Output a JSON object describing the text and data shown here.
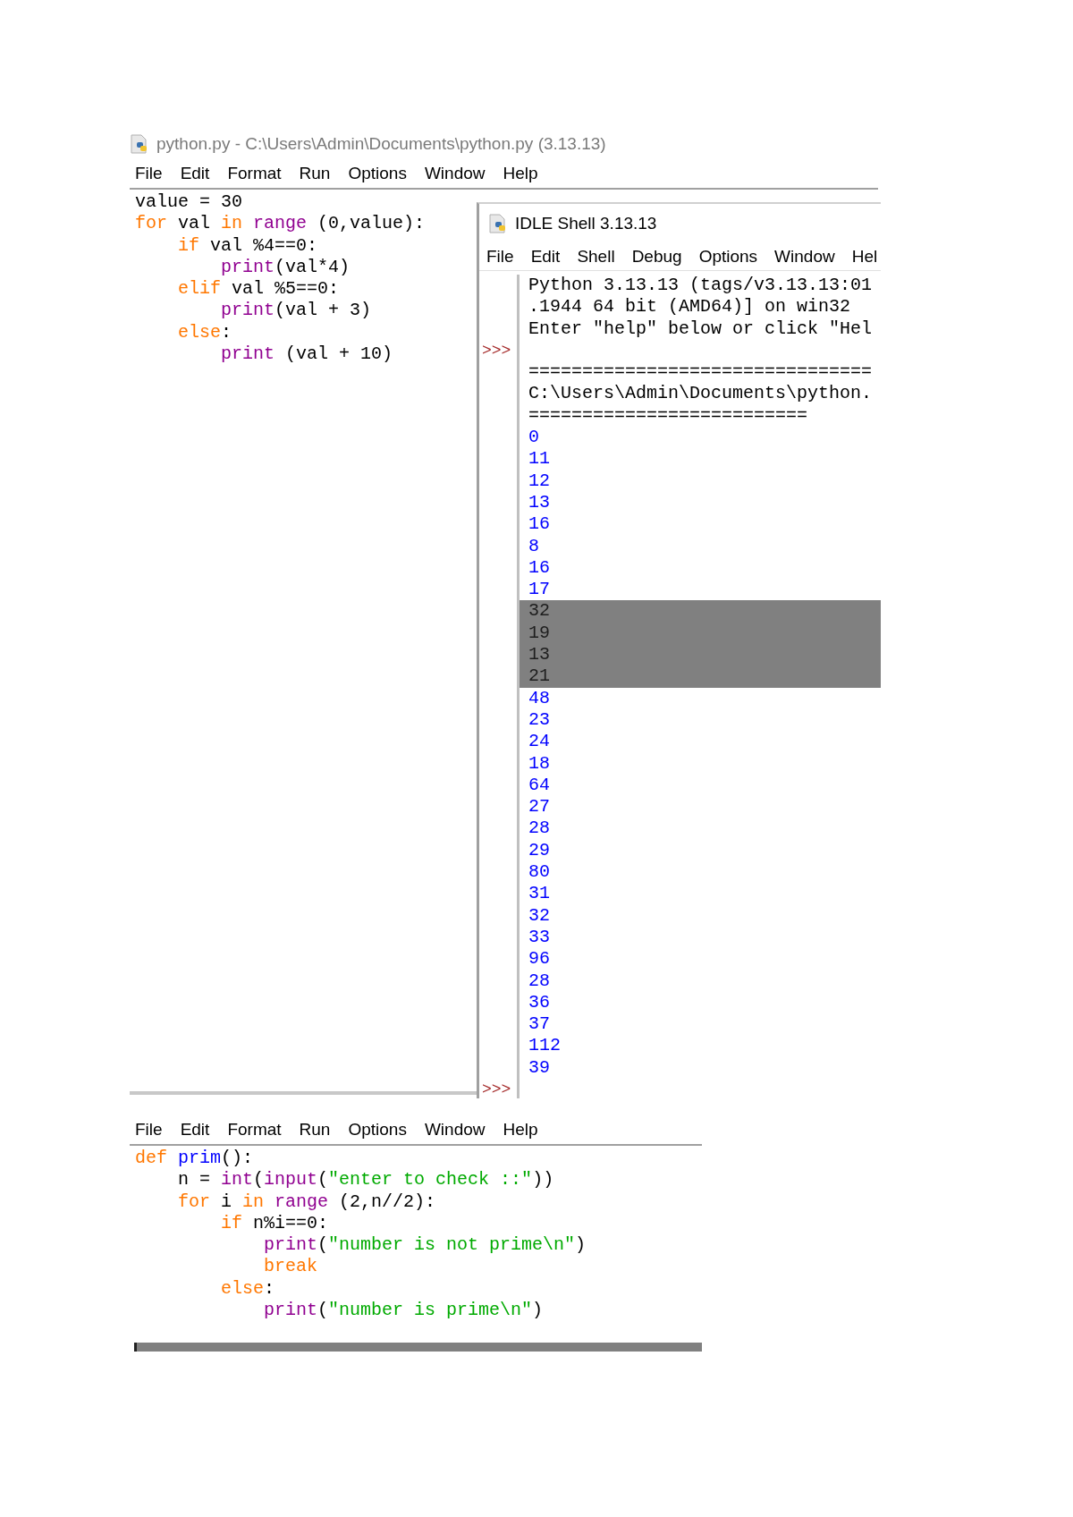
{
  "editor": {
    "title": "python.py - C:\\Users\\Admin\\Documents\\python.py (3.13.13)",
    "menu": [
      "File",
      "Edit",
      "Format",
      "Run",
      "Options",
      "Window",
      "Help"
    ],
    "code": [
      [
        {
          "text": "value = 30",
          "kind": "plain"
        }
      ],
      [
        {
          "text": "for",
          "kind": "keyword"
        },
        {
          "text": " val ",
          "kind": "plain"
        },
        {
          "text": "in",
          "kind": "keyword"
        },
        {
          "text": " range",
          "kind": "builtin"
        },
        {
          "text": " (0,value):",
          "kind": "plain"
        }
      ],
      [
        {
          "text": "    if",
          "kind": "keyword"
        },
        {
          "text": " val %4==0:",
          "kind": "plain"
        }
      ],
      [
        {
          "text": "        print",
          "kind": "builtin"
        },
        {
          "text": "(val*4)",
          "kind": "plain"
        }
      ],
      [
        {
          "text": "    elif",
          "kind": "keyword"
        },
        {
          "text": " val %5==0:",
          "kind": "plain"
        }
      ],
      [
        {
          "text": "        print",
          "kind": "builtin"
        },
        {
          "text": "(val + 3)",
          "kind": "plain"
        }
      ],
      [
        {
          "text": "    else",
          "kind": "keyword"
        },
        {
          "text": ":",
          "kind": "plain"
        }
      ],
      [
        {
          "text": "        print",
          "kind": "builtin"
        },
        {
          "text": " (val + 10)",
          "kind": "plain"
        }
      ]
    ]
  },
  "shell": {
    "title": "IDLE Shell 3.13.13",
    "menu": [
      "File",
      "Edit",
      "Shell",
      "Debug",
      "Options",
      "Window",
      "Hel"
    ],
    "lines": [
      {
        "kind": "header",
        "text": "Python 3.13.13 (tags/v3.13.13:01",
        "selected": false
      },
      {
        "kind": "header",
        "text": ".1944 64 bit (AMD64)] on win32",
        "selected": false
      },
      {
        "kind": "header",
        "text": "Enter \"help\" below or click \"Hel",
        "selected": false
      },
      {
        "kind": "prompt",
        "prompt": ">>>",
        "selected": false
      },
      {
        "kind": "header",
        "text": "================================",
        "selected": false
      },
      {
        "kind": "header",
        "text": "C:\\Users\\Admin\\Documents\\python.",
        "selected": false
      },
      {
        "kind": "header",
        "text": "==========================",
        "selected": false
      },
      {
        "kind": "output",
        "text": "0",
        "selected": false
      },
      {
        "kind": "output",
        "text": "11",
        "selected": false
      },
      {
        "kind": "output",
        "text": "12",
        "selected": false
      },
      {
        "kind": "output",
        "text": "13",
        "selected": false
      },
      {
        "kind": "output",
        "text": "16",
        "selected": false
      },
      {
        "kind": "output",
        "text": "8",
        "selected": false
      },
      {
        "kind": "output",
        "text": "16",
        "selected": false
      },
      {
        "kind": "output",
        "text": "17",
        "selected": false
      },
      {
        "kind": "output",
        "text": "32",
        "selected": true
      },
      {
        "kind": "output",
        "text": "19",
        "selected": true
      },
      {
        "kind": "output",
        "text": "13",
        "selected": true
      },
      {
        "kind": "output",
        "text": "21",
        "selected": true
      },
      {
        "kind": "output",
        "text": "48",
        "selected": false
      },
      {
        "kind": "output",
        "text": "23",
        "selected": false
      },
      {
        "kind": "output",
        "text": "24",
        "selected": false
      },
      {
        "kind": "output",
        "text": "18",
        "selected": false
      },
      {
        "kind": "output",
        "text": "64",
        "selected": false
      },
      {
        "kind": "output",
        "text": "27",
        "selected": false
      },
      {
        "kind": "output",
        "text": "28",
        "selected": false
      },
      {
        "kind": "output",
        "text": "29",
        "selected": false
      },
      {
        "kind": "output",
        "text": "80",
        "selected": false
      },
      {
        "kind": "output",
        "text": "31",
        "selected": false
      },
      {
        "kind": "output",
        "text": "32",
        "selected": false
      },
      {
        "kind": "output",
        "text": "33",
        "selected": false
      },
      {
        "kind": "output",
        "text": "96",
        "selected": false
      },
      {
        "kind": "output",
        "text": "28",
        "selected": false
      },
      {
        "kind": "output",
        "text": "36",
        "selected": false
      },
      {
        "kind": "output",
        "text": "37",
        "selected": false
      },
      {
        "kind": "output",
        "text": "112",
        "selected": false
      },
      {
        "kind": "output",
        "text": "39",
        "selected": false
      },
      {
        "kind": "prompt",
        "prompt": ">>>",
        "selected": false
      }
    ]
  },
  "editor_2": {
    "menu": [
      "File",
      "Edit",
      "Format",
      "Run",
      "Options",
      "Window",
      "Help"
    ],
    "code": [
      [
        {
          "text": "def",
          "kind": "keyword"
        },
        {
          "text": " prim",
          "kind": "definition"
        },
        {
          "text": "():",
          "kind": "plain"
        }
      ],
      [
        {
          "text": "    n = ",
          "kind": "plain"
        },
        {
          "text": "int",
          "kind": "builtin"
        },
        {
          "text": "(",
          "kind": "plain"
        },
        {
          "text": "input",
          "kind": "builtin"
        },
        {
          "text": "(",
          "kind": "plain"
        },
        {
          "text": "\"enter to check ::\"",
          "kind": "string"
        },
        {
          "text": "))",
          "kind": "plain"
        }
      ],
      [
        {
          "text": "    for",
          "kind": "keyword"
        },
        {
          "text": " i ",
          "kind": "plain"
        },
        {
          "text": "in",
          "kind": "keyword"
        },
        {
          "text": " range",
          "kind": "builtin"
        },
        {
          "text": " (2,n//2):",
          "kind": "plain"
        }
      ],
      [
        {
          "text": "        if",
          "kind": "keyword"
        },
        {
          "text": " n%i==0:",
          "kind": "plain"
        }
      ],
      [
        {
          "text": "            print",
          "kind": "builtin"
        },
        {
          "text": "(",
          "kind": "plain"
        },
        {
          "text": "\"number is not prime\\n\"",
          "kind": "string"
        },
        {
          "text": ")",
          "kind": "plain"
        }
      ],
      [
        {
          "text": "            break",
          "kind": "keyword"
        }
      ],
      [
        {
          "text": "        else",
          "kind": "keyword"
        },
        {
          "text": ":",
          "kind": "plain"
        }
      ],
      [
        {
          "text": "            print",
          "kind": "builtin"
        },
        {
          "text": "(",
          "kind": "plain"
        },
        {
          "text": "\"number is prime\\n\"",
          "kind": "string"
        },
        {
          "text": ")",
          "kind": "plain"
        }
      ]
    ]
  }
}
